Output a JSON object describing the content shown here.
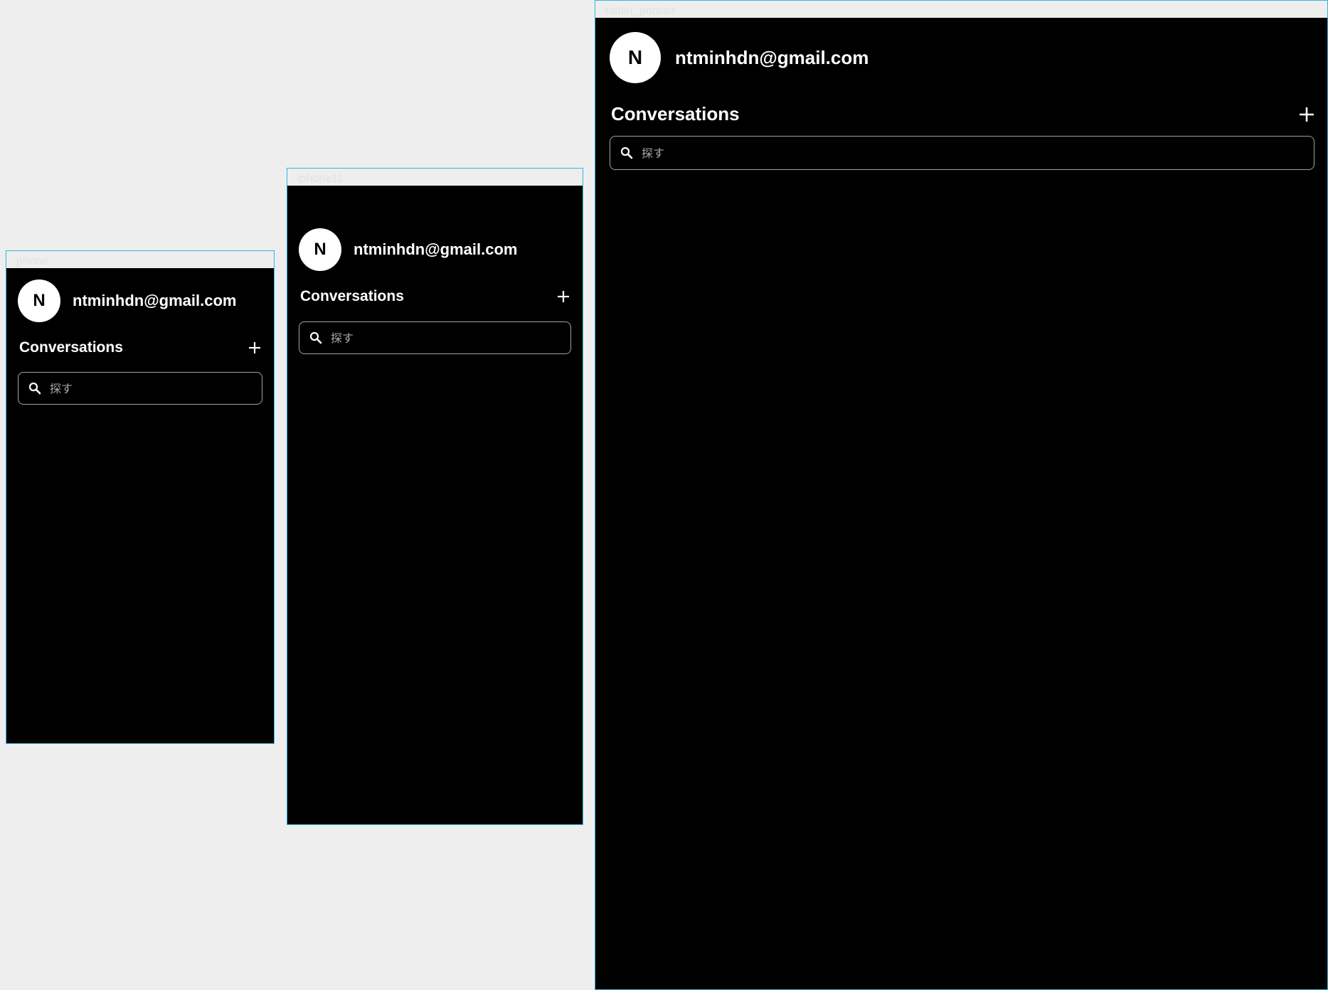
{
  "frames": [
    {
      "label": "phone",
      "avatar_initial": "N",
      "email": "ntminhdn@gmail.com",
      "conversations_title": "Conversations",
      "search_placeholder": "探す"
    },
    {
      "label": "iphone11",
      "avatar_initial": "N",
      "email": "ntminhdn@gmail.com",
      "conversations_title": "Conversations",
      "search_placeholder": "探す"
    },
    {
      "label": "tablet_portrait",
      "avatar_initial": "N",
      "email": "ntminhdn@gmail.com",
      "conversations_title": "Conversations",
      "search_placeholder": "探す"
    }
  ],
  "icons": {
    "add": "plus-icon",
    "search": "search-icon"
  },
  "colors": {
    "canvas_background": "#eeeeee",
    "frame_border": "#36b4e3",
    "screen_background": "#000000",
    "text": "#ffffff",
    "search_border": "#a3a3a3",
    "placeholder": "#a9a9a9"
  }
}
